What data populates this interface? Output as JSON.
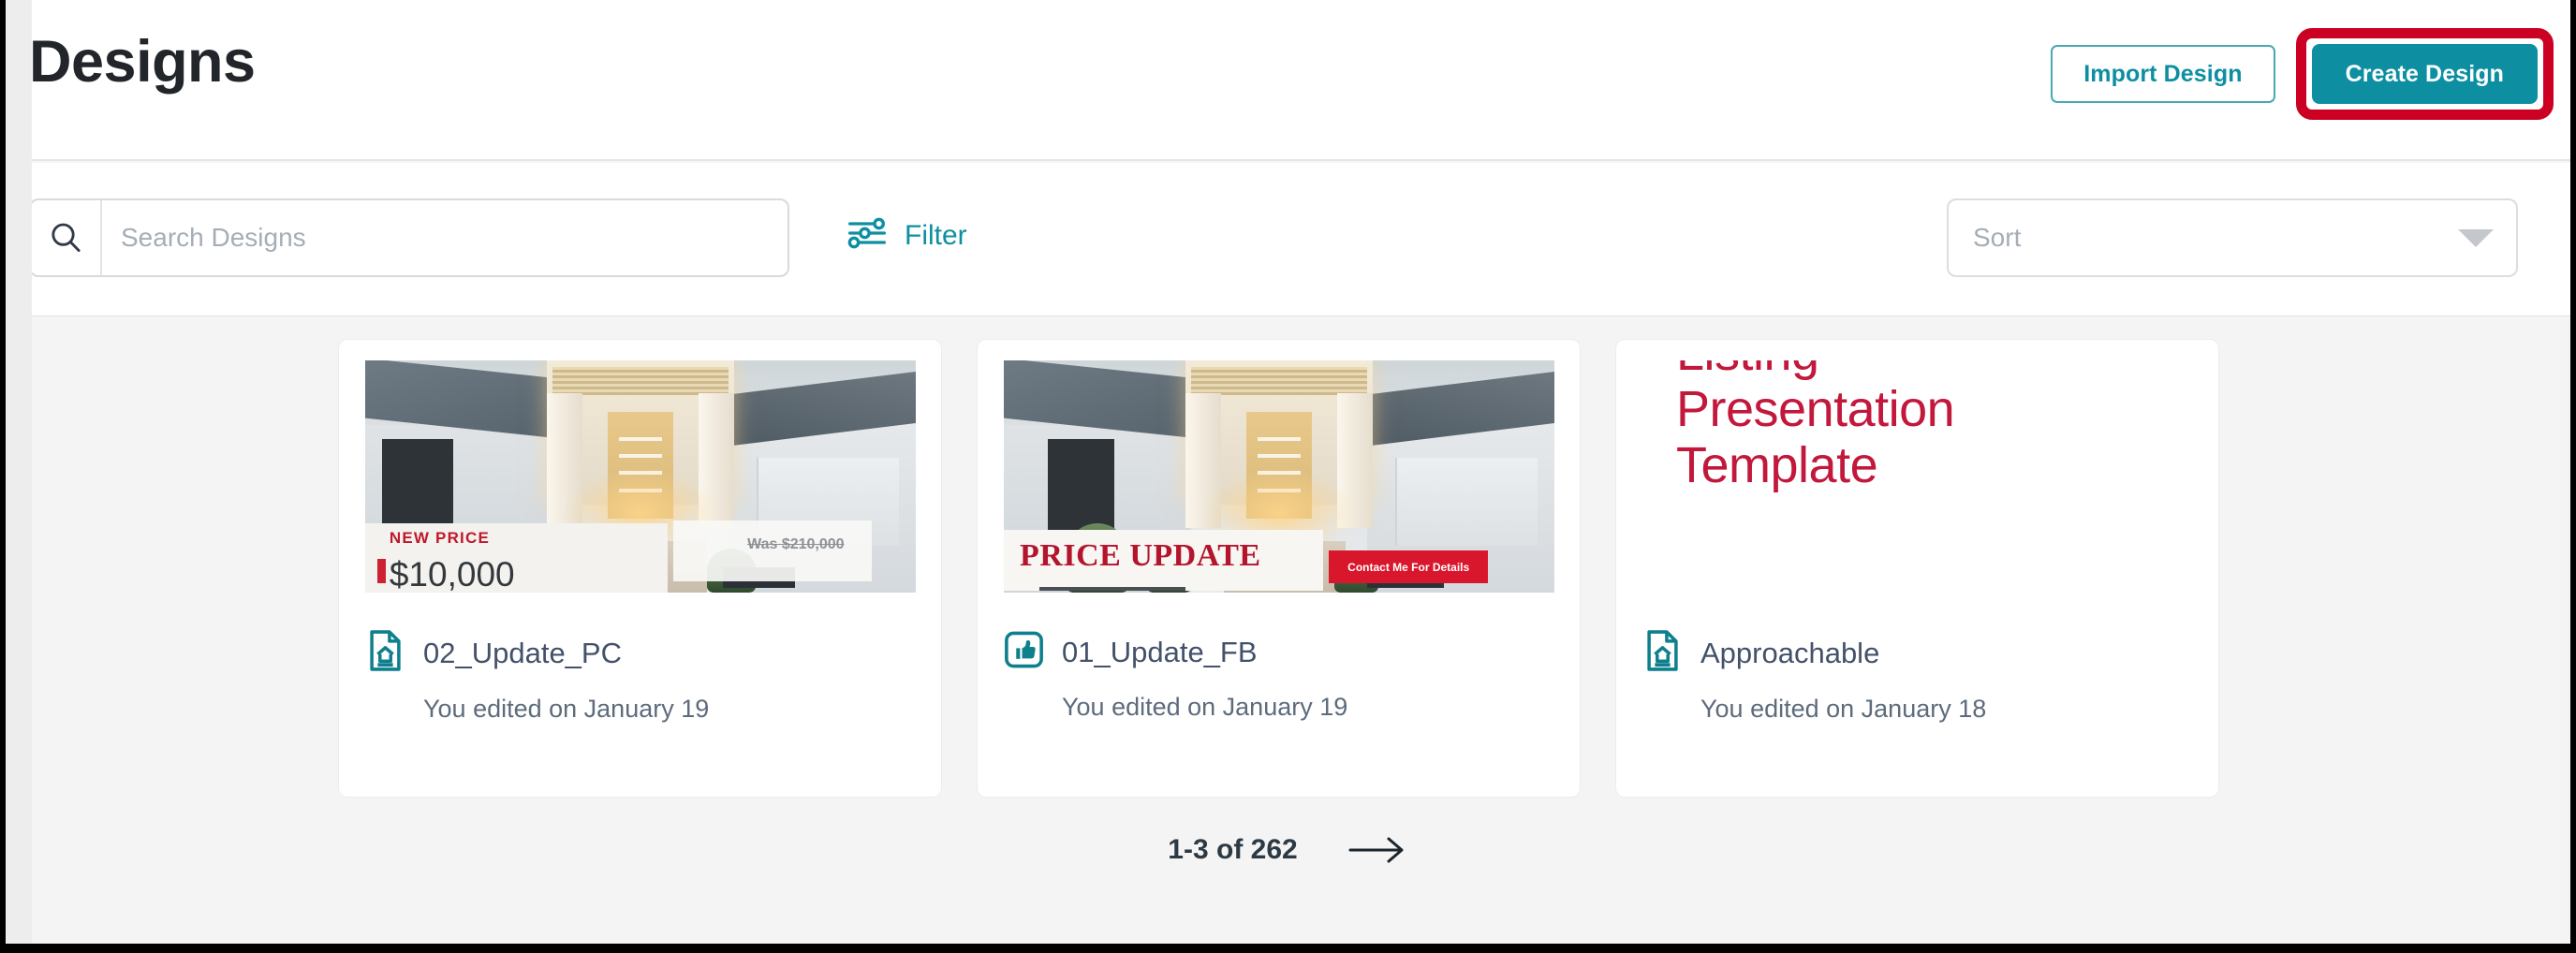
{
  "header": {
    "title": "Designs",
    "import_label": "Import Design",
    "create_label": "Create Design"
  },
  "toolbar": {
    "search_placeholder": "Search Designs",
    "search_value": "",
    "search_icon": "search-icon",
    "filter_label": "Filter",
    "filter_icon": "sliders-icon",
    "sort_value": "Sort",
    "sort_icon": "chevron-down-icon"
  },
  "cards": [
    {
      "title": "02_Update_PC",
      "subtitle": "You edited on January 19",
      "icon": "document-house-icon",
      "thumb_type": "house-photo",
      "overlay": {
        "banner": "NEW PRICE",
        "price": "$10,000",
        "was": "Was $210,000"
      }
    },
    {
      "title": "01_Update_FB",
      "subtitle": "You edited on January 19",
      "icon": "thumbs-up-icon",
      "thumb_type": "house-photo",
      "overlay": {
        "banner": "PRICE UPDATE",
        "cta": "Contact Me For Details"
      }
    },
    {
      "title": "Approachable",
      "subtitle": "You edited on January 18",
      "icon": "document-house-icon",
      "thumb_type": "text-template",
      "template_lines": [
        "Listing",
        "Presentation",
        "Template"
      ]
    }
  ],
  "pagination": {
    "range": "1-3 of 262",
    "next_icon": "arrow-right-icon"
  },
  "colors": {
    "teal": "#0d8fa1",
    "teal_border": "#48a8b5",
    "annotation_red": "#cc0022",
    "template_red": "#c2183c",
    "page_bg": "#f4f4f4",
    "card_title": "#43516a"
  }
}
